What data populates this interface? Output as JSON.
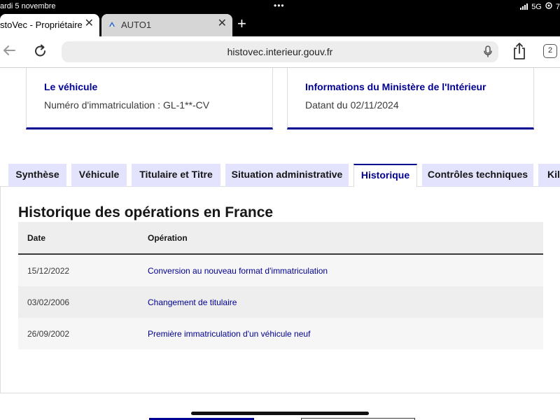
{
  "status_bar": {
    "time": "ardi 5 novembre",
    "dots": "•••",
    "network": "5G",
    "battery": "7"
  },
  "browser": {
    "tabs": [
      {
        "title": "stoVec - Propriétaire",
        "close": "✕"
      },
      {
        "title": "AUTO1",
        "close": "✕"
      }
    ],
    "new_tab": "+",
    "url": "histovec.interieur.gouv.fr",
    "tab_count": "2"
  },
  "page": {
    "cards": [
      {
        "title": "Le véhicule",
        "text": "Numéro d'immatriculation : GL-1**-CV"
      },
      {
        "title": "Informations du Ministère de l'Intérieur",
        "text": "Datant du 02/11/2024"
      }
    ],
    "tabs": [
      {
        "label": "Synthèse"
      },
      {
        "label": "Véhicule"
      },
      {
        "label": "Titulaire et Titre"
      },
      {
        "label": "Situation administrative"
      },
      {
        "label": "Historique"
      },
      {
        "label": "Contrôles techniques"
      },
      {
        "label": "Kilo"
      }
    ],
    "selected_tab": "Historique",
    "section_title": "Historique des opérations en France",
    "table": {
      "headers": [
        "Date",
        "Opération"
      ],
      "rows": [
        {
          "date": "15/12/2022",
          "operation": "Conversion au nouveau format d'immatriculation"
        },
        {
          "date": "03/02/2006",
          "operation": "Changement de titulaire"
        },
        {
          "date": "26/09/2002",
          "operation": "Première immatriculation d'un véhicule neuf"
        }
      ]
    }
  },
  "colors": {
    "primary": "#000091",
    "tab_bg": "#e3e3fd",
    "table_header_bg": "#eeeeee"
  }
}
